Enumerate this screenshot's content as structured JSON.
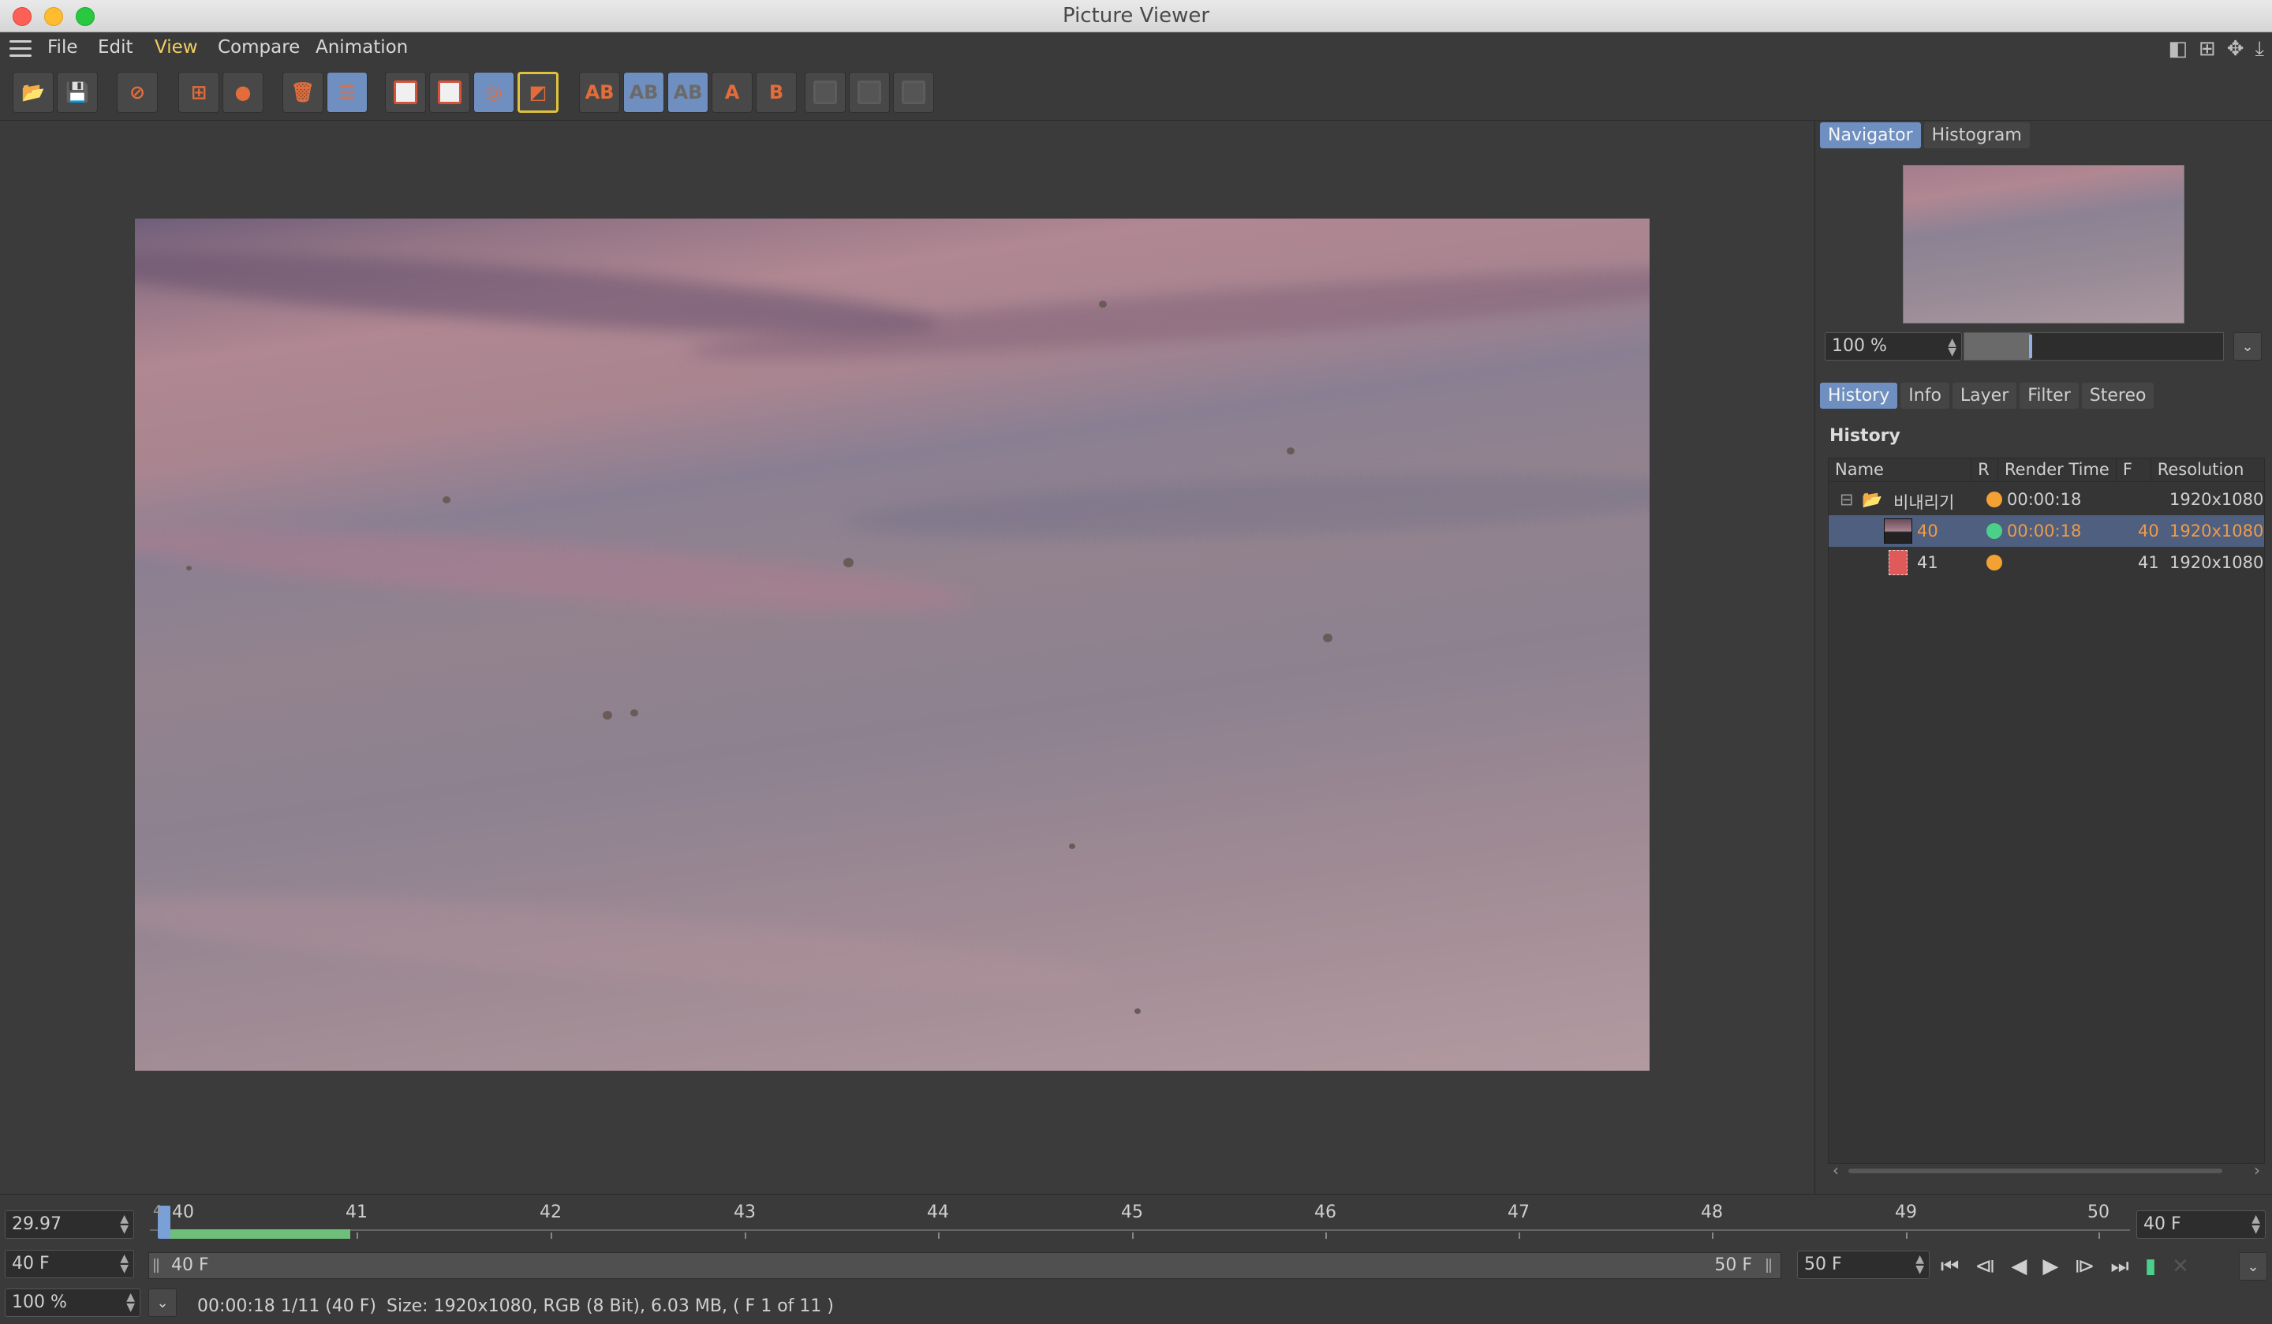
{
  "window": {
    "title": "Picture Viewer"
  },
  "menu": {
    "file": "File",
    "edit": "Edit",
    "view": "View",
    "compare": "Compare",
    "animation": "Animation"
  },
  "toolbar": {
    "ab_label": "AB",
    "a_label": "A",
    "b_label": "B"
  },
  "panel": {
    "tabs_top": [
      "Navigator",
      "Histogram"
    ],
    "zoom_value": "100 %",
    "tabs_bottom": [
      "History",
      "Info",
      "Layer",
      "Filter",
      "Stereo"
    ],
    "history_title": "History",
    "columns": [
      "Name",
      "R",
      "Render Time",
      "F",
      "Resolution"
    ],
    "rows": [
      {
        "name": "비내리기",
        "render_time": "00:00:18",
        "frame": "",
        "resolution": "1920x1080",
        "status_color": "#f4a133"
      },
      {
        "name": "40",
        "render_time": "00:00:18",
        "frame": "40",
        "resolution": "1920x1080",
        "status_color": "#4bd08a"
      },
      {
        "name": "41",
        "render_time": "",
        "frame": "41",
        "resolution": "1920x1080",
        "status_color": "#f4a133"
      }
    ]
  },
  "timeline": {
    "fps": "29.97",
    "current_frame": "40 F",
    "end_frame_field": "40 F",
    "ticks": [
      "40",
      "41",
      "42",
      "43",
      "44",
      "45",
      "46",
      "47",
      "48",
      "49",
      "50"
    ],
    "tick_prefix": "4",
    "range_start": "40 F",
    "range_end": "50 F",
    "end_field": "50 F",
    "zoom": "100 %"
  },
  "status": {
    "time": "00:00:18 1/11 (40 F)",
    "info": "Size: 1920x1080, RGB (8 Bit), 6.03 MB,  ( F 1 of 11 )"
  }
}
